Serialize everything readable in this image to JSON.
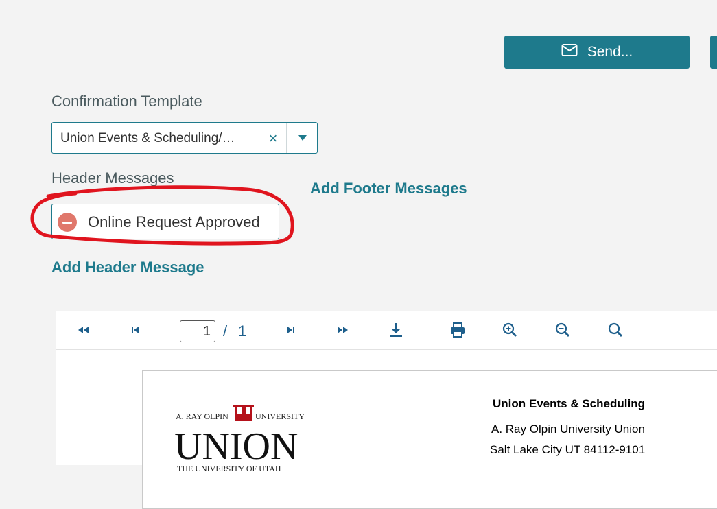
{
  "toolbar": {
    "send_label": "Send..."
  },
  "confirmation": {
    "label": "Confirmation Template",
    "selected": "Union Events & Scheduling/…",
    "clear_glyph": "×"
  },
  "header_messages": {
    "label": "Header Messages",
    "items": [
      {
        "text": "Online Request Approved"
      }
    ],
    "add_label": "Add Header Message"
  },
  "footer": {
    "add_label": "Add Footer Messages"
  },
  "annotation": {
    "color": "#e0141e"
  },
  "viewer": {
    "current_page": "1",
    "separator": "/",
    "total_pages": "1",
    "icons": [
      "first-page-icon",
      "previous-page-icon",
      "next-page-icon",
      "last-page-icon",
      "download-icon",
      "print-icon",
      "zoom-in-icon",
      "zoom-out-icon",
      "search-icon"
    ]
  },
  "document": {
    "logo": {
      "top": "A. RAY OLPIN",
      "top_right": "UNIVERSITY",
      "main": "UNION",
      "bottom": "THE UNIVERSITY OF UTAH"
    },
    "org_name": "Union Events & Scheduling",
    "address_line1": "A. Ray Olpin University Union",
    "address_line2": "Salt Lake City UT 84112-9101"
  },
  "colors": {
    "accent": "#1e7a8c",
    "remove": "#e0776b",
    "background": "#f3f3f3"
  }
}
